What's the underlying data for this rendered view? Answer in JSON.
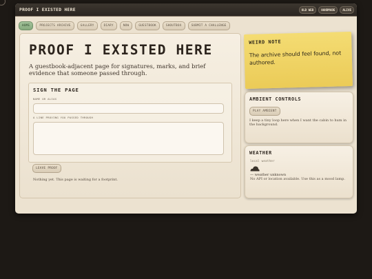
{
  "header": {
    "site_title": "PROOF I EXISTED HERE",
    "badges": [
      "OLD WEB",
      "HANDMADE",
      "ALIVE"
    ]
  },
  "nav": {
    "items": [
      {
        "label": "HOME",
        "active": true
      },
      {
        "label": "PROJECTS ARCHIVE",
        "active": false
      },
      {
        "label": "GALLERY",
        "active": false
      },
      {
        "label": "DIARY",
        "active": false
      },
      {
        "label": "NOW",
        "active": false
      },
      {
        "label": "GUESTBOOK",
        "active": false
      },
      {
        "label": "SHOUTBOX",
        "active": false
      },
      {
        "label": "SUBMIT A CHALLENGE",
        "active": false
      }
    ]
  },
  "main": {
    "title": "PROOF I EXISTED HERE",
    "subtitle": "A guestbook-adjacent page for signatures, marks, and brief evidence that someone passed through.",
    "sign": {
      "heading": "SIGN THE PAGE",
      "name_label": "NAME OR ALIAS",
      "name_value": "",
      "line_label": "A LINE PROVING YOU PASSED THROUGH",
      "line_value": "",
      "submit_label": "LEAVE PROOF"
    },
    "empty_message": "Nothing yet. This page is waiting for a footprint."
  },
  "sidebar": {
    "note": {
      "title": "WEIRD NOTE",
      "text": "The archive should feel found, not authored."
    },
    "ambient": {
      "title": "AMBIENT CONTROLS",
      "button_label": "PLAY AMBIENT",
      "note": "I keep a tiny loop here when I want the cabin to hum in the background."
    },
    "weather": {
      "title": "WEATHER",
      "subtitle": "local weather",
      "icon": "cloud-icon",
      "status": "— weather unknown",
      "note": "No API or location available. Use this as a mood lamp."
    }
  },
  "colors": {
    "page_background": "#1d1915",
    "panel": "#ece2d0",
    "titlebar": "#2b2621",
    "active_nav": "#8fb086",
    "sticky_note": "#f0d562",
    "ink": "#2c241d"
  }
}
